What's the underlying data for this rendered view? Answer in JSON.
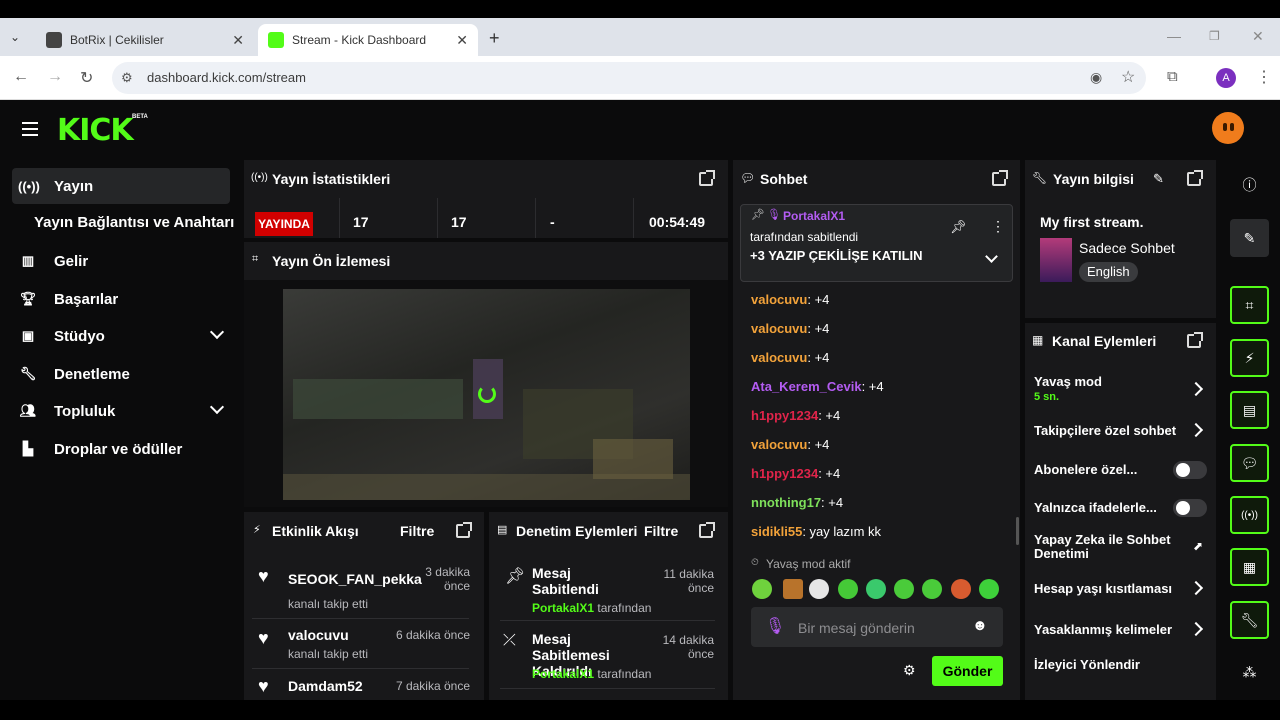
{
  "browser": {
    "tabs": [
      {
        "label": "BotRix | Cekilisler",
        "active": false
      },
      {
        "label": "Stream - Kick Dashboard",
        "active": true
      }
    ],
    "url": "dashboard.kick.com/stream",
    "profile_initial": "A"
  },
  "app": {
    "logo": "KICK",
    "badge": "BETA"
  },
  "sidebar": {
    "items": [
      {
        "label": "Yayın",
        "icon": "broadcast-icon"
      },
      {
        "label": "Yayın Bağlantısı ve Anahtarı"
      },
      {
        "label": "Gelir",
        "icon": "chart-icon"
      },
      {
        "label": "Başarılar",
        "icon": "trophy-icon"
      },
      {
        "label": "Stüdyo",
        "icon": "studio-icon"
      },
      {
        "label": "Denetleme",
        "icon": "wrench-icon"
      },
      {
        "label": "Topluluk",
        "icon": "community-icon"
      },
      {
        "label": "Droplar ve ödüller",
        "icon": "gift-icon"
      }
    ]
  },
  "stats": {
    "title": "Yayın İstatistikleri",
    "status": "YAYINDA",
    "viewers": "17",
    "followers": "17",
    "subs": "-",
    "uptime": "00:54:49"
  },
  "preview": {
    "title": "Yayın Ön İzlemesi"
  },
  "activity": {
    "title": "Etkinlik Akışı",
    "filter": "Filtre",
    "items": [
      {
        "name": "SEOOK_FAN_pekka",
        "sub": "kanalı takip etti",
        "time": "3 dakika önce"
      },
      {
        "name": "valocuvu",
        "sub": "kanalı takip etti",
        "time": "6 dakika önce"
      },
      {
        "name": "Damdam52",
        "time": "7 dakika önce"
      }
    ]
  },
  "modactions": {
    "title": "Denetim Eylemleri",
    "filter": "Filtre",
    "items": [
      {
        "title": "Mesaj Sabitlendi",
        "user": "PortakalX1",
        "by": "tarafından",
        "time": "11 dakika önce"
      },
      {
        "title": "Mesaj Sabitlemesi Kaldırıldı",
        "user": "PortakalX1",
        "by": "tarafından",
        "time": "14 dakika önce"
      }
    ]
  },
  "chat": {
    "title": "Sohbet",
    "pinned": {
      "user": "PortakalX1",
      "by": "tarafından sabitlendi",
      "message": "+3 YAZIP ÇEKİLİŞE KATILIN"
    },
    "messages": [
      {
        "user": "valocuvu",
        "text": ": +4",
        "color": "#f2a23a"
      },
      {
        "user": "valocuvu",
        "text": ": +4",
        "color": "#f2a23a"
      },
      {
        "user": "valocuvu",
        "text": ": +4",
        "color": "#f2a23a"
      },
      {
        "user": "Ata_Kerem_Cevik",
        "text": ": +4",
        "color": "#b45cf2"
      },
      {
        "user": "h1ppy1234",
        "text": ": +4",
        "color": "#e0244a"
      },
      {
        "user": "valocuvu",
        "text": ": +4",
        "color": "#f2a23a"
      },
      {
        "user": "h1ppy1234",
        "text": ": +4",
        "color": "#e0244a"
      },
      {
        "user": "nnothing17",
        "text": ": +4",
        "color": "#7ee05b"
      },
      {
        "user": "sidikli55",
        "text": ": yay lazım kk",
        "color": "#f2a23a"
      }
    ],
    "slowmode": "Yavaş mod aktif",
    "placeholder": "Bir mesaj gönderin",
    "send": "Gönder"
  },
  "streaminfo": {
    "title": "Yayın bilgisi",
    "stream_title": "My first stream.",
    "category": "Sadece Sohbet",
    "language": "English"
  },
  "channel_actions": {
    "title": "Kanal Eylemleri",
    "items": [
      {
        "label": "Yavaş mod",
        "value": "5 sn."
      },
      {
        "label": "Takipçilere özel sohbet"
      },
      {
        "label": "Abonelere özel..."
      },
      {
        "label": "Yalnızca ifadelerle..."
      },
      {
        "label": "Yapay Zeka ile Sohbet Denetimi"
      },
      {
        "label": "Hesap yaşı kısıtlaması"
      },
      {
        "label": "Yasaklanmış kelimeler"
      },
      {
        "label": "İzleyici Yönlendir"
      }
    ]
  },
  "colors": {
    "accent": "#53fc18",
    "live": "#d10000",
    "bg": "#0b0b0c",
    "panel": "#18181a"
  }
}
